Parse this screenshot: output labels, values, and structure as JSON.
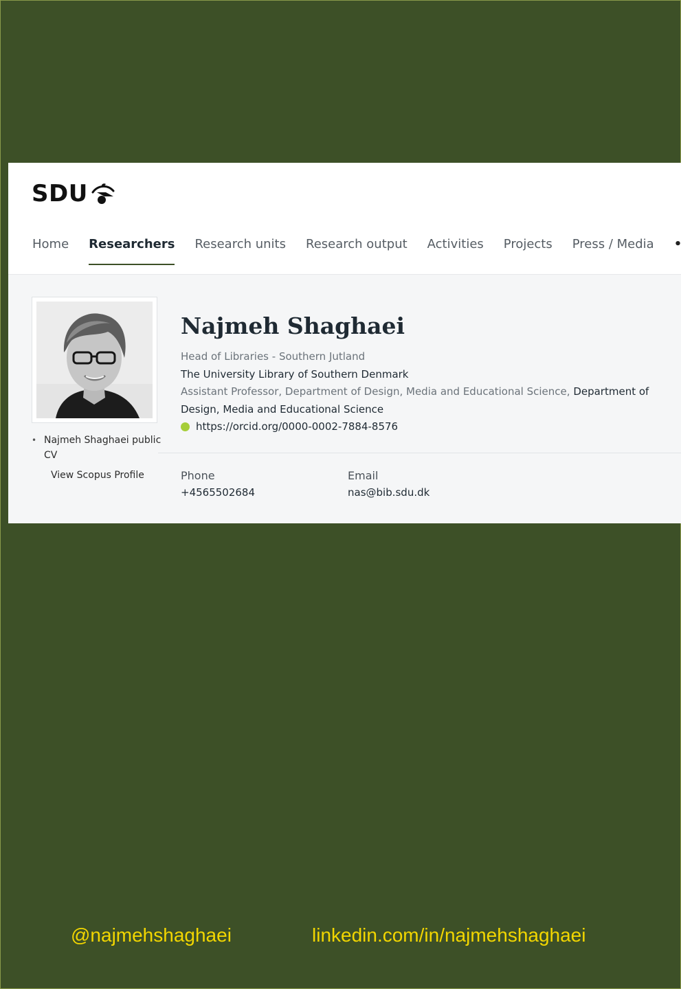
{
  "brand": {
    "logo_text": "SDU",
    "logo_icon": "sdu-leaf-icon"
  },
  "nav": {
    "items": [
      {
        "label": "Home",
        "active": false
      },
      {
        "label": "Researchers",
        "active": true
      },
      {
        "label": "Research units",
        "active": false
      },
      {
        "label": "Research output",
        "active": false
      },
      {
        "label": "Activities",
        "active": false
      },
      {
        "label": "Projects",
        "active": false
      },
      {
        "label": "Press / Media",
        "active": false
      }
    ],
    "more_label": "•••"
  },
  "profile": {
    "name": "Najmeh Shaghaei",
    "title": "Head of Libraries - Southern Jutland",
    "organization": "The University Library of Southern Denmark",
    "position_prefix": "Assistant Professor, Department of Design, Media and Educational Science, ",
    "position_dept": "Department of",
    "position_dept_line2": "Design, Media and Educational Science",
    "orcid_url": "https://orcid.org/0000-0002-7884-8576",
    "cv_link": "Najmeh Shaghaei public CV",
    "scopus_link": "View Scopus Profile"
  },
  "contact": {
    "phone_label": "Phone",
    "phone": "+4565502684",
    "email_label": "Email",
    "email": "nas@bib.sdu.dk"
  },
  "footer": {
    "handle": "@najmehshaghaei",
    "linkedin": "linkedin.com/in/najmehshaghaei"
  },
  "colors": {
    "background": "#3d5027",
    "accent_yellow": "#f2d600",
    "orcid_green": "#a6ce39"
  }
}
